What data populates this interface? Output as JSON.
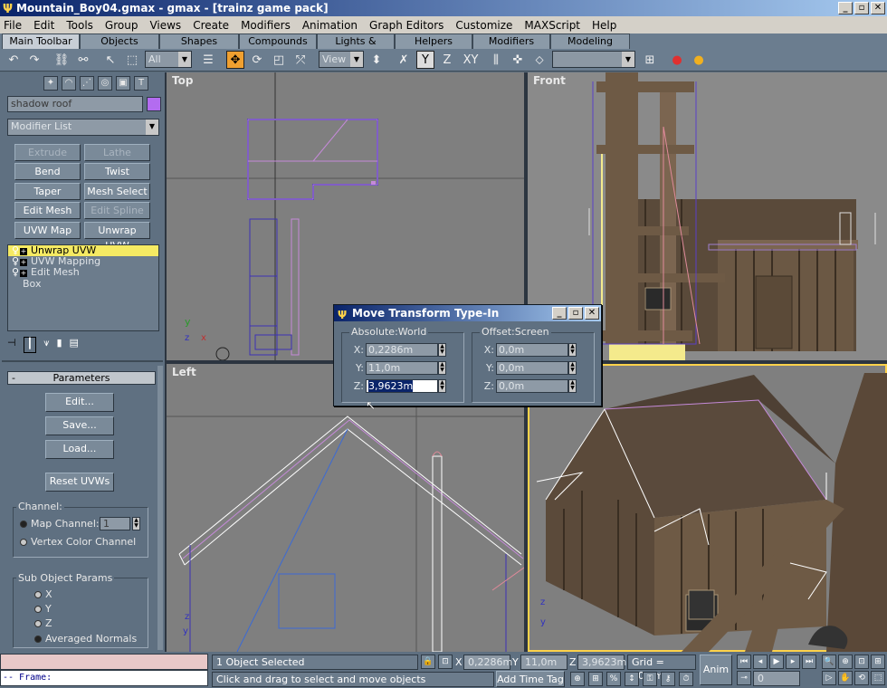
{
  "app": {
    "title": "Mountain_Boy04.gmax - gmax - [trainz game pack]",
    "min": "_",
    "max": "▫",
    "close": "✕"
  },
  "menu": [
    "File",
    "Edit",
    "Tools",
    "Group",
    "Views",
    "Create",
    "Modifiers",
    "Animation",
    "Graph Editors",
    "Customize",
    "MAXScript",
    "Help"
  ],
  "tabs": [
    "Main Toolbar",
    "Objects",
    "Shapes",
    "Compounds",
    "Lights & Cameras",
    "Helpers",
    "Modifiers",
    "Modeling"
  ],
  "toolbar": {
    "selection_filter": "All",
    "ref_coord": "View",
    "axes": [
      "Y",
      "Z",
      "XY"
    ],
    "named_selection": ""
  },
  "command_panel": {
    "object_name": "shadow roof",
    "object_color": "#b36cf0",
    "modifier_list": "Modifier List",
    "buttons": [
      [
        "Extrude",
        "Lathe"
      ],
      [
        "Bend",
        "Twist"
      ],
      [
        "Taper",
        "Mesh Select"
      ],
      [
        "Edit Mesh",
        "Edit Spline"
      ],
      [
        "UVW Map",
        "Unwrap UVW"
      ]
    ],
    "disabled_buttons": [
      "Extrude",
      "Lathe",
      "Edit Spline"
    ],
    "stack": [
      {
        "label": "Unwrap UVW",
        "selected": true,
        "bulb": true,
        "plus": true
      },
      {
        "label": "UVW Mapping",
        "selected": false,
        "bulb": true,
        "plus": true
      },
      {
        "label": "Edit Mesh",
        "selected": false,
        "bulb": true,
        "plus": true
      },
      {
        "label": "Box",
        "selected": false,
        "bulb": false,
        "plus": false
      }
    ],
    "parameters": {
      "header": "Parameters",
      "collapse": "-",
      "edit": "Edit...",
      "save": "Save...",
      "load": "Load...",
      "reset": "Reset UVWs",
      "channel_group": "Channel:",
      "map_channel": "Map Channel:",
      "map_channel_value": "1",
      "vertex_color": "Vertex Color Channel",
      "sub_object_group": "Sub Object Params",
      "axes": [
        "X",
        "Y",
        "Z"
      ],
      "averaged_normals": "Averaged Normals"
    }
  },
  "viewports": {
    "top": "Top",
    "front": "Front",
    "left": "Left",
    "perspective": ""
  },
  "dialog": {
    "title": "Move Transform Type-In",
    "absolute_label": "Absolute:World",
    "offset_label": "Offset:Screen",
    "absolute": {
      "x": "0,2286m",
      "y": "11,0m",
      "z": "3,9623m"
    },
    "offset": {
      "x": "0,0m",
      "y": "0,0m",
      "z": "0,0m"
    }
  },
  "status": {
    "prompt_label": "-- Frame:",
    "selection": "1 Object Selected",
    "hint": "Click and drag to select and move objects",
    "x": "0,2286m",
    "y": "11,0m",
    "z": "3,9623m",
    "grid": "Grid = 10,0m",
    "add_time_tag": "Add Time Tag",
    "anim": "Anim",
    "frame": "0",
    "coord_labels": [
      "X",
      "Y",
      "Z"
    ]
  }
}
